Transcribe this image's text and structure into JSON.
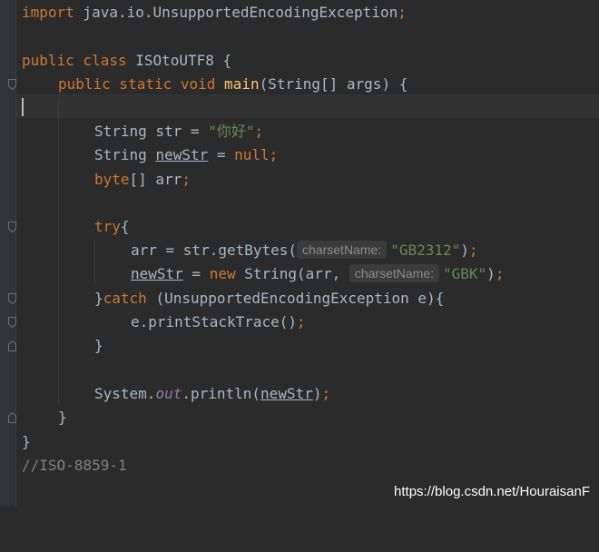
{
  "code": {
    "line1": {
      "kw": "import",
      "rest": " java.io.UnsupportedEncodingException",
      "semi": ";"
    },
    "line3": {
      "kw1": "public",
      "kw2": " class",
      "rest": " ISOtoUTF8 {"
    },
    "line4": {
      "kw1": "public",
      "kw2": " static",
      "kw3": " void",
      "fn": " main",
      "rest": "(String[] args) {"
    },
    "line6": {
      "type": "String",
      "rest": " str = ",
      "str": "\"你好\"",
      "semi": ";"
    },
    "line7": {
      "type": "String",
      "var": "newStr",
      "rest": " = ",
      "kw": "null",
      "semi": ";"
    },
    "line8": {
      "kw": "byte",
      "rest": "[] arr",
      "semi": ";"
    },
    "line10": {
      "kw": "try",
      "rest": "{"
    },
    "line11": {
      "pre": "arr = str.getBytes(",
      "hint": "charsetName:",
      "str": "\"GB2312\"",
      "post": ")",
      "semi": ";"
    },
    "line12": {
      "var": "newStr",
      "mid": " = ",
      "kw": "new",
      "pre": " String(arr,",
      "comma": " ",
      "hint": "charsetName:",
      "str": "\"GBK\"",
      "post": ")",
      "semi": ";"
    },
    "line13": {
      "pre": "}",
      "kw": "catch",
      "rest": " (UnsupportedEncodingException e){"
    },
    "line14": {
      "pre": "e.printStackTrace()",
      "semi": ";"
    },
    "line15": {
      "text": "}"
    },
    "line17": {
      "pre": "System.",
      "field": "out",
      "mid": ".println(",
      "var": "newStr",
      "post": ")",
      "semi": ";"
    },
    "line18": {
      "text": "}"
    },
    "line19": {
      "text": "}"
    },
    "line20": {
      "comment": "//ISO-8859-1"
    }
  },
  "watermark": "https://blog.csdn.net/HouraisanF",
  "colors": {
    "background": "#2b2b2b",
    "keyword": "#cc7832",
    "string": "#6a8759",
    "method": "#ffc66d",
    "default": "#a9b7c6",
    "comment": "#808080",
    "static_field": "#9876aa"
  },
  "gutter_icons": [
    "fold-marker-icon"
  ]
}
